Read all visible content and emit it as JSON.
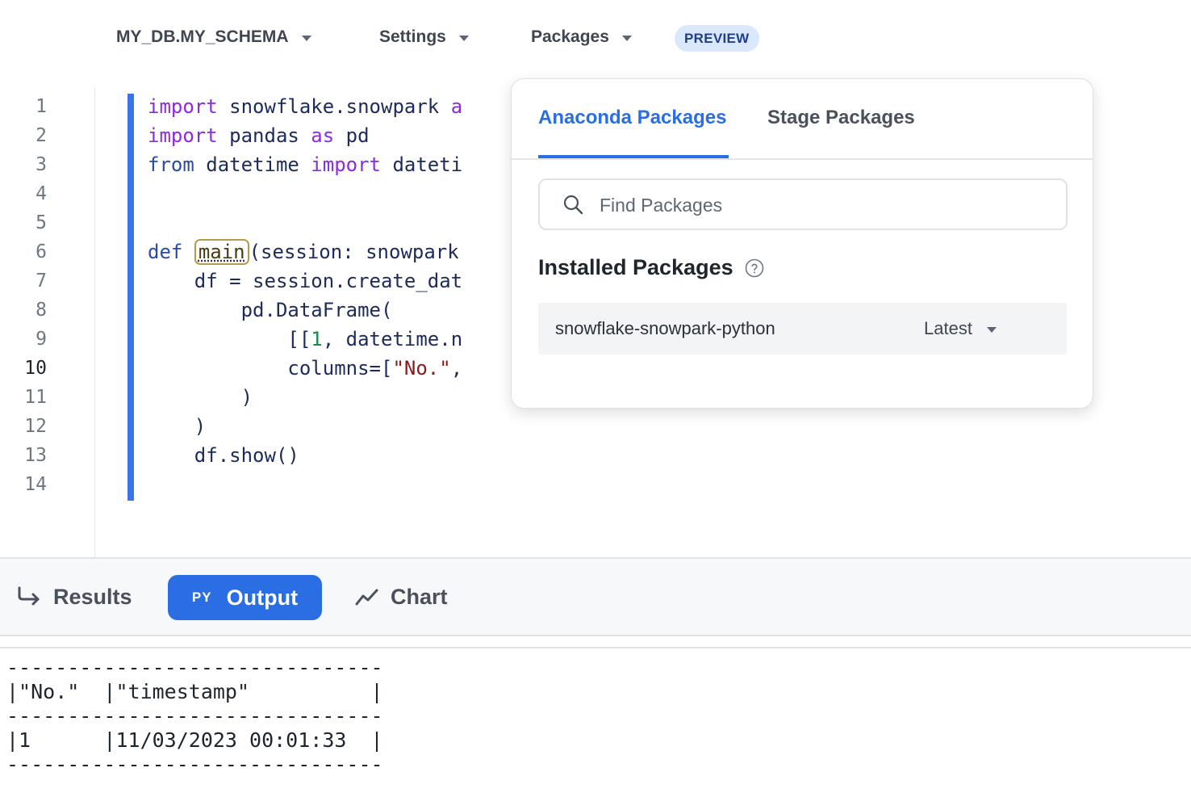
{
  "toolbar": {
    "context": "MY_DB.MY_SCHEMA",
    "settings": "Settings",
    "packages": "Packages",
    "badge": "PREVIEW"
  },
  "editor": {
    "line_numbers": [
      "1",
      "2",
      "3",
      "4",
      "5",
      "6",
      "7",
      "8",
      "9",
      "10",
      "11",
      "12",
      "13",
      "14"
    ],
    "active_line": "10",
    "lines": [
      [
        [
          "kw",
          "import"
        ],
        [
          "t",
          " snowflake.snowpark "
        ],
        [
          "kw",
          "a"
        ]
      ],
      [
        [
          "kw",
          "import"
        ],
        [
          "t",
          " pandas "
        ],
        [
          "kw",
          "as"
        ],
        [
          "t",
          " pd"
        ]
      ],
      [
        [
          "kw2",
          "from"
        ],
        [
          "t",
          " datetime "
        ],
        [
          "kw",
          "import"
        ],
        [
          "t",
          " dateti"
        ]
      ],
      [],
      [],
      [
        [
          "kw2",
          "def"
        ],
        [
          "t",
          " "
        ],
        [
          "hl",
          "main"
        ],
        [
          "t",
          "(session: snowpark"
        ]
      ],
      [
        [
          "t",
          "    df = session.create_dat"
        ]
      ],
      [
        [
          "t",
          "        pd.DataFrame("
        ]
      ],
      [
        [
          "t",
          "            [["
        ],
        [
          "num",
          "1"
        ],
        [
          "t",
          ", datetime.n"
        ]
      ],
      [
        [
          "t",
          "            columns=["
        ],
        [
          "str",
          "\"No.\""
        ],
        [
          "t",
          ","
        ]
      ],
      [
        [
          "t",
          "        )"
        ]
      ],
      [
        [
          "t",
          "    )"
        ]
      ],
      [
        [
          "t",
          "    df.show()"
        ]
      ],
      []
    ]
  },
  "popover": {
    "tabs": [
      "Anaconda Packages",
      "Stage Packages"
    ],
    "search_placeholder": "Find Packages",
    "installed_title": "Installed Packages",
    "packages": [
      {
        "name": "snowflake-snowpark-python",
        "version": "Latest"
      }
    ]
  },
  "results_bar": {
    "results": "Results",
    "py": "PY",
    "output": "Output",
    "chart": "Chart"
  },
  "output_lines": [
    "-------------------------------",
    "|\"No.\"  |\"timestamp\"          |",
    "-------------------------------",
    "|1      |11/03/2023 00:01:33  |",
    "-------------------------------"
  ]
}
